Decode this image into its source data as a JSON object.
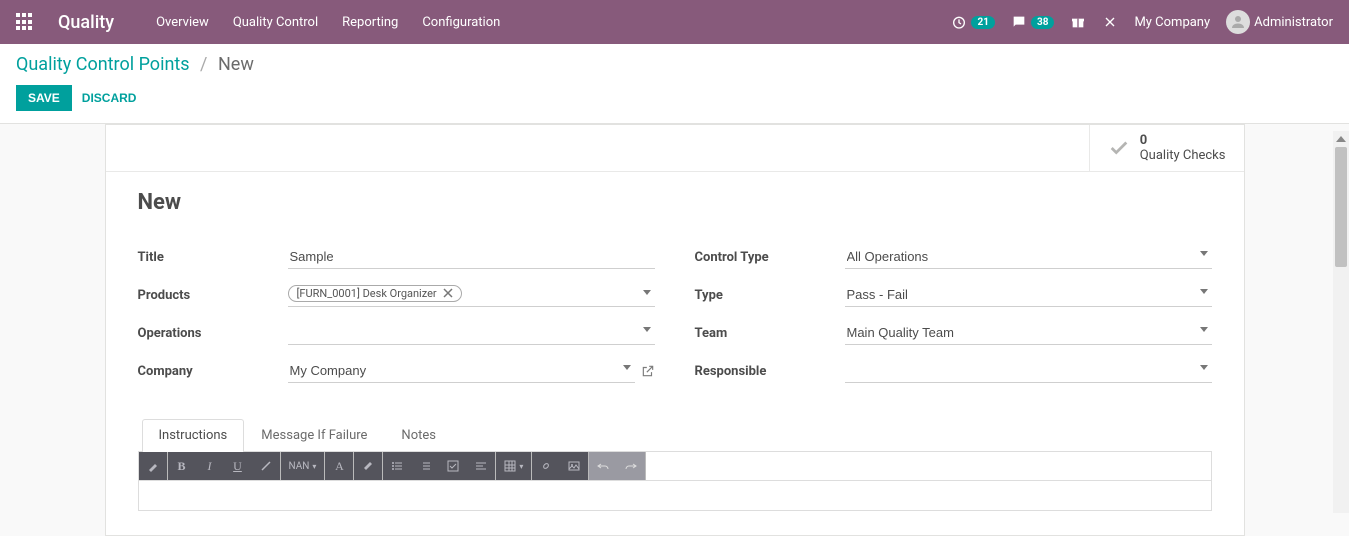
{
  "navbar": {
    "brand": "Quality",
    "menu": [
      "Overview",
      "Quality Control",
      "Reporting",
      "Configuration"
    ],
    "timer_count": "21",
    "chat_count": "38",
    "company": "My Company",
    "user": "Administrator"
  },
  "breadcrumb": {
    "parent": "Quality Control Points",
    "current": "New"
  },
  "buttons": {
    "save": "SAVE",
    "discard": "DISCARD"
  },
  "stat": {
    "count": "0",
    "label": "Quality Checks"
  },
  "record": {
    "title_h1": "New",
    "left": {
      "title_label": "Title",
      "title_value": "Sample",
      "products_label": "Products",
      "products_tag": "[FURN_0001] Desk Organizer",
      "operations_label": "Operations",
      "operations_value": "",
      "company_label": "Company",
      "company_value": "My Company"
    },
    "right": {
      "control_type_label": "Control Type",
      "control_type_value": "All Operations",
      "type_label": "Type",
      "type_value": "Pass - Fail",
      "team_label": "Team",
      "team_value": "Main Quality Team",
      "responsible_label": "Responsible",
      "responsible_value": ""
    }
  },
  "tabs": {
    "instructions": "Instructions",
    "failure": "Message If Failure",
    "notes": "Notes"
  },
  "toolbar": {
    "nan": "NAN"
  }
}
